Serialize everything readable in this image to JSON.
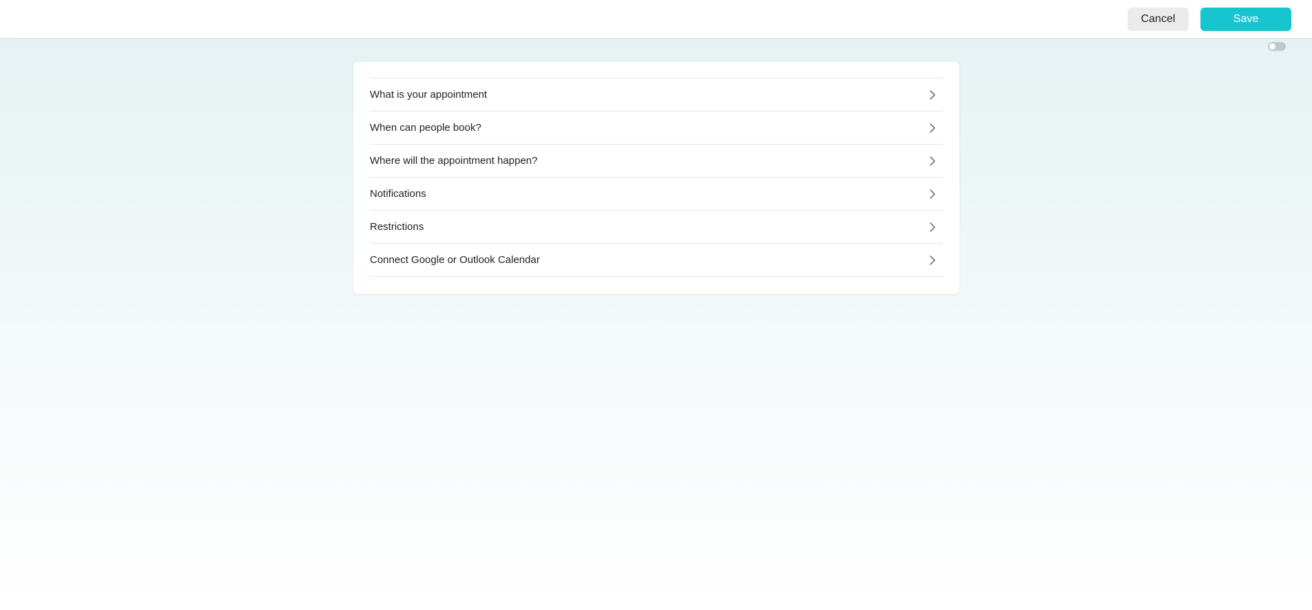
{
  "header": {
    "cancel_label": "Cancel",
    "save_label": "Save"
  },
  "toggle": {
    "on": false
  },
  "settings": {
    "items": [
      {
        "label": "What is your appointment",
        "icon": "chevron-right-icon"
      },
      {
        "label": "When can people book?",
        "icon": "chevron-right-icon"
      },
      {
        "label": "Where will the appointment happen?",
        "icon": "chevron-right-icon"
      },
      {
        "label": "Notifications",
        "icon": "chevron-right-icon"
      },
      {
        "label": "Restrictions",
        "icon": "chevron-right-icon"
      },
      {
        "label": "Connect Google or Outlook Calendar",
        "icon": "chevron-right-icon"
      }
    ]
  },
  "colors": {
    "accent": "#17c5cf",
    "cancel_bg": "#ebebeb",
    "background_top": "#e3f1f2"
  }
}
